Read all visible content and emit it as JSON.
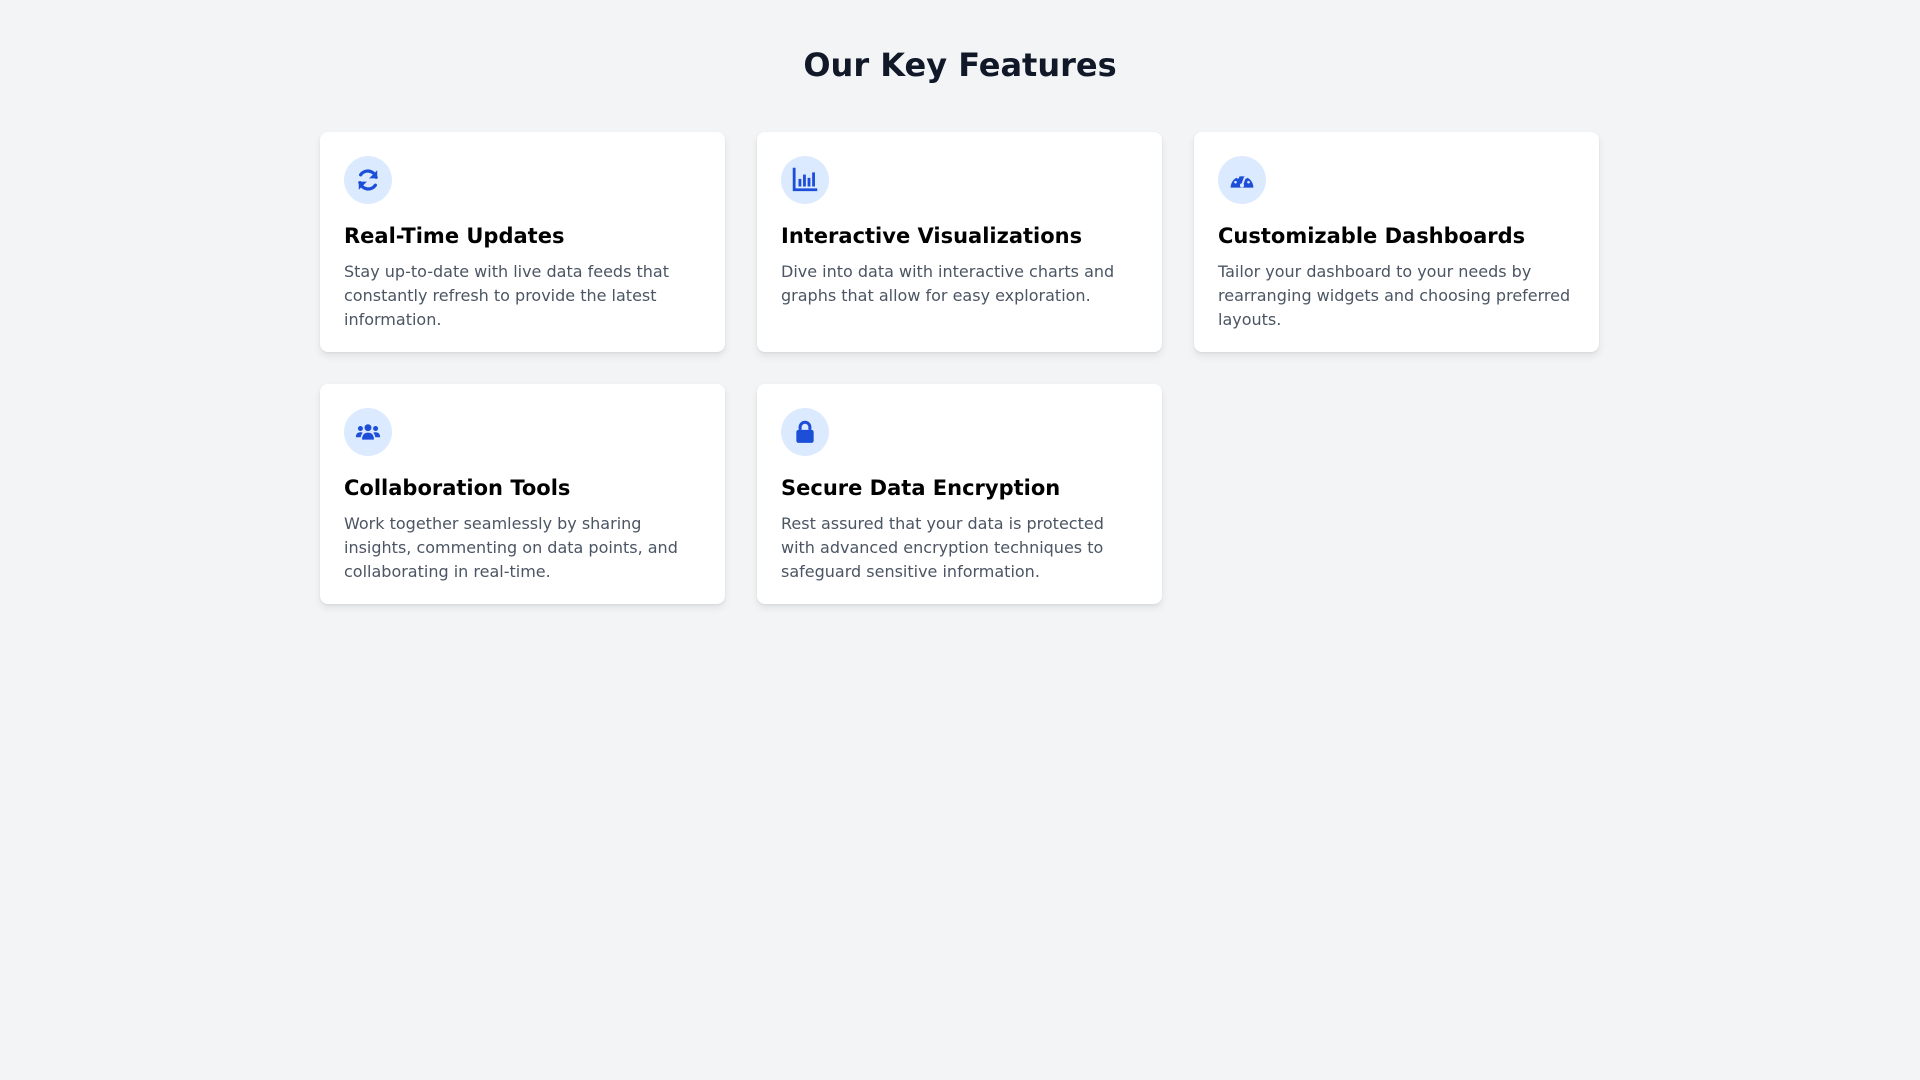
{
  "page": {
    "title": "Our Key Features"
  },
  "colors": {
    "background": "#f3f4f6",
    "accent": "#1d4ed8",
    "icon_bg": "#dbeafe",
    "text_muted": "#4b5563"
  },
  "features": [
    {
      "icon": "refresh-icon",
      "title": "Real-Time Updates",
      "description": "Stay up-to-date with live data feeds that constantly refresh to provide the latest information."
    },
    {
      "icon": "bar-chart-icon",
      "title": "Interactive Visualizations",
      "description": "Dive into data with interactive charts and graphs that allow for easy exploration."
    },
    {
      "icon": "gauge-icon",
      "title": "Customizable Dashboards",
      "description": "Tailor your dashboard to your needs by rearranging widgets and choosing preferred layouts."
    },
    {
      "icon": "users-icon",
      "title": "Collaboration Tools",
      "description": "Work together seamlessly by sharing insights, commenting on data points, and collaborating in real-time."
    },
    {
      "icon": "lock-icon",
      "title": "Secure Data Encryption",
      "description": "Rest assured that your data is protected with advanced encryption techniques to safeguard sensitive information."
    }
  ]
}
